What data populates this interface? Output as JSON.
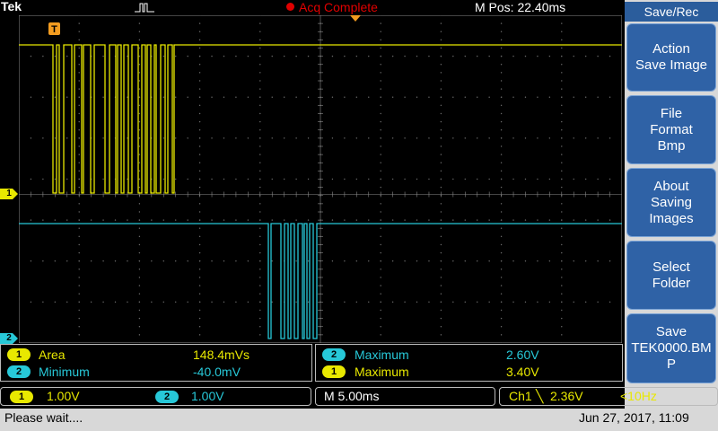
{
  "header": {
    "brand": "Tek",
    "acquisition_status": "Acq Complete",
    "mpos": "M Pos: 22.40ms"
  },
  "side_menu": {
    "title": "Save/Rec",
    "buttons": [
      {
        "label": "Action\nSave Image"
      },
      {
        "label": "File\nFormat\nBmp"
      },
      {
        "label": "About\nSaving\nImages"
      },
      {
        "label": "Select\nFolder"
      },
      {
        "label": "Save\nTEK0000.BM\nP"
      }
    ]
  },
  "markers": {
    "ch1": "1",
    "ch2": "2",
    "trigger": "T"
  },
  "measurements": [
    {
      "channel": "1",
      "name": "Area",
      "value": "148.4mVs"
    },
    {
      "channel": "2",
      "name": "Minimum",
      "value": "-40.0mV"
    },
    {
      "channel": "2",
      "name": "Maximum",
      "value": "2.60V"
    },
    {
      "channel": "1",
      "name": "Maximum",
      "value": "3.40V"
    }
  ],
  "status": {
    "ch1_badge": "1",
    "ch1_scale": "1.00V",
    "ch2_badge": "2",
    "ch2_scale": "1.00V",
    "timebase": "M 5.00ms",
    "trigger_channel": "Ch1",
    "trigger_slope": "╲",
    "trigger_level": "2.36V",
    "trigger_freq": "<10Hz"
  },
  "footer": {
    "message": "Please wait....",
    "datetime": "Jun 27, 2017, 11:09"
  },
  "colors": {
    "ch1": "#e8e800",
    "ch2": "#27c8d8",
    "menu": "#2f62a6",
    "acq": "#e00000"
  }
}
